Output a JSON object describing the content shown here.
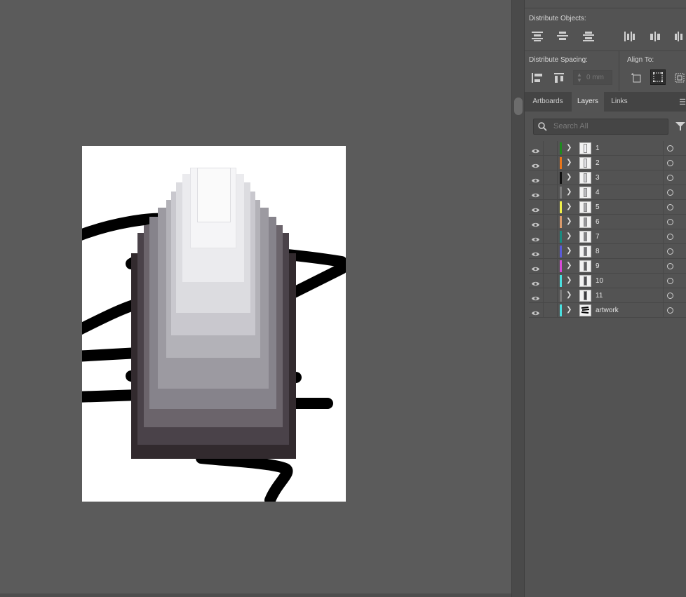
{
  "align_panel": {
    "distribute_objects_label": "Distribute Objects:",
    "distribute_spacing_label": "Distribute Spacing:",
    "align_to_label": "Align To:",
    "spacing_value": "0 mm"
  },
  "panel_tabs": [
    {
      "label": "Artboards",
      "active": false
    },
    {
      "label": "Layers",
      "active": true
    },
    {
      "label": "Links",
      "active": false
    }
  ],
  "layers_panel": {
    "search_placeholder": "Search All",
    "layers": [
      {
        "name": "1",
        "color": "#1f8a1f"
      },
      {
        "name": "2",
        "color": "#e8751a"
      },
      {
        "name": "3",
        "color": "#111111"
      },
      {
        "name": "4",
        "color": "#7b7b7b"
      },
      {
        "name": "5",
        "color": "#f0f04a"
      },
      {
        "name": "6",
        "color": "#d99a6c"
      },
      {
        "name": "7",
        "color": "#1a8a80"
      },
      {
        "name": "8",
        "color": "#5a5ad8"
      },
      {
        "name": "9",
        "color": "#d84ad8"
      },
      {
        "name": "10",
        "color": "#4ae0e0"
      },
      {
        "name": "11",
        "color": "#7b7b7b"
      },
      {
        "name": "artwork",
        "color": "#4ae0e0"
      }
    ]
  },
  "artwork": {
    "fills": [
      "#322a2e",
      "#4a4249",
      "#6b646b",
      "#86838b",
      "#9c9aa1",
      "#b3b2b8",
      "#c9c8ce",
      "#dcdce0",
      "#ebebee",
      "#f5f5f7",
      "#fafafa"
    ]
  }
}
